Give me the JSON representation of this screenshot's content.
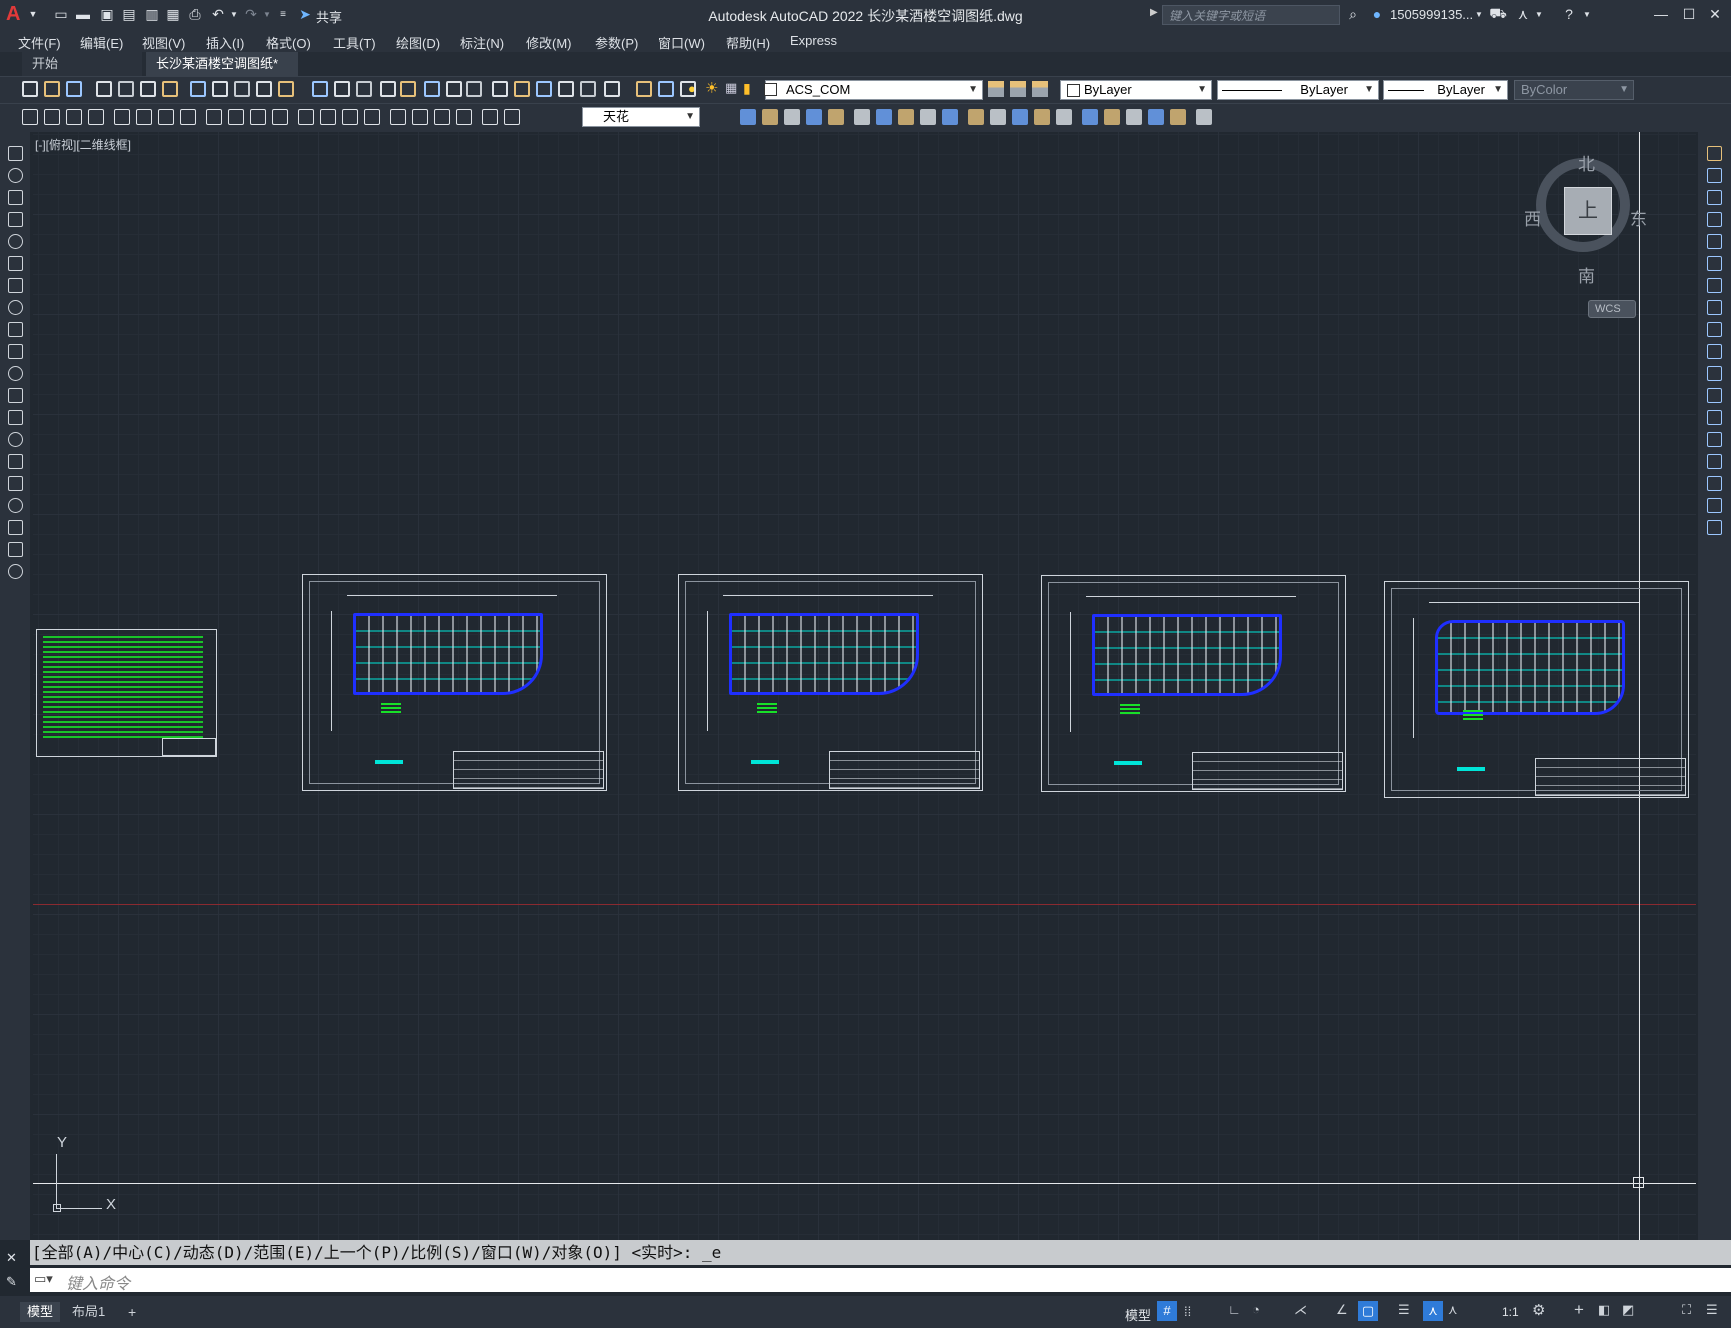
{
  "titlebar": {
    "title": "Autodesk AutoCAD 2022    长沙某酒楼空调图纸.dwg",
    "share_label": "共享",
    "search_placeholder": "键入关键字或短语",
    "user": "1505999135...",
    "app_letter": "A"
  },
  "menu": [
    "文件(F)",
    "编辑(E)",
    "视图(V)",
    "插入(I)",
    "格式(O)",
    "工具(T)",
    "绘图(D)",
    "标注(N)",
    "修改(M)",
    "参数(P)",
    "窗口(W)",
    "帮助(H)",
    "Express"
  ],
  "tabs": {
    "start": "开始",
    "drawing": "长沙某酒楼空调图纸*",
    "close": "×",
    "add": "+"
  },
  "properties": {
    "layer": "ACS_COM",
    "color": "ByLayer",
    "linetype": "ByLayer",
    "lineweight": "ByLayer",
    "plotstyle": "ByColor",
    "layer2": "天花"
  },
  "viewport": {
    "label": "[-][俯视][二维线框]",
    "north": "北",
    "south": "南",
    "east": "东",
    "west": "西",
    "cube_face": "上",
    "wcs": "WCS",
    "ucs_x": "X",
    "ucs_y": "Y"
  },
  "command": {
    "history": "[全部(A)/中心(C)/动态(D)/范围(E)/上一个(P)/比例(S)/窗口(W)/对象(O)] <实时>: _e",
    "placeholder": "键入命令"
  },
  "statusbar": {
    "model_tab": "模型",
    "layout_tab": "布局1",
    "add_tab": "+",
    "model_label": "模型",
    "scale": "1:1"
  },
  "colors": {
    "accent_red": "#d42a2a",
    "bg": "#212830",
    "ui": "#2b323c",
    "cad_blue": "#1f2fff",
    "cad_cyan": "#00e5d8",
    "cad_green": "#18e028"
  }
}
